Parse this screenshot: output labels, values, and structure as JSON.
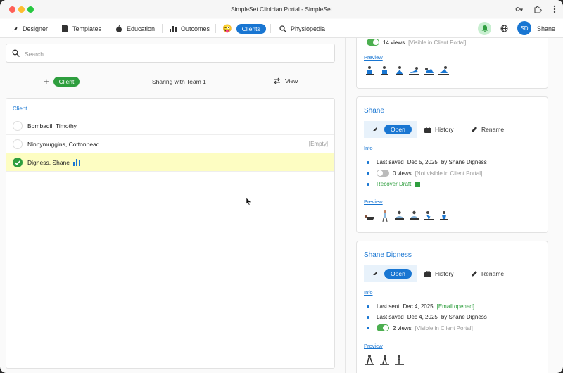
{
  "window": {
    "title": "SimpleSet Clinician Portal - SimpleSet"
  },
  "nav": {
    "designer": "Designer",
    "templates": "Templates",
    "education": "Education",
    "outcomes": "Outcomes",
    "emoji": "😜",
    "clients": "Clients",
    "physiopedia": "Physiopedia",
    "avatar_initials": "SD",
    "user_name": "Shane"
  },
  "search": {
    "placeholder": "Search"
  },
  "toolbar": {
    "add_label": "Client",
    "sharing": "Sharing with Team 1",
    "view": "View"
  },
  "client_list": {
    "header": "Client",
    "rows": [
      {
        "name": "Bombadil, Timothy",
        "meta": ""
      },
      {
        "name": "Ninnymuggins, Cottonhead",
        "meta": "[Empty]"
      },
      {
        "name": "Digness, Shane",
        "meta": ""
      }
    ]
  },
  "cards": [
    {
      "title": "",
      "views": "14 views",
      "views_note": "[Visible in Client Portal]",
      "preview": "Preview"
    },
    {
      "title": "Shane",
      "open": "Open",
      "history": "History",
      "rename": "Rename",
      "info": "Info",
      "last_saved_label": "Last saved",
      "last_saved_date": "Dec 5, 2025",
      "last_saved_by": "by Shane Digness",
      "views": "0 views",
      "views_note": "[Not visible in Client Portal]",
      "recover": "Recover Draft",
      "preview": "Preview"
    },
    {
      "title": "Shane Digness",
      "open": "Open",
      "history": "History",
      "rename": "Rename",
      "info": "Info",
      "last_sent_label": "Last sent",
      "last_sent_date": "Dec 4, 2025",
      "last_sent_note": "[Email opened]",
      "last_saved_label": "Last saved",
      "last_saved_date": "Dec 4, 2025",
      "last_saved_by": "by Shane Digness",
      "views": "2 views",
      "views_note": "[Visible in Client Portal]",
      "preview": "Preview"
    }
  ],
  "colors": {
    "accent": "#1976d2",
    "green": "#2e9e3e",
    "selected_row": "#fdfdc2"
  }
}
